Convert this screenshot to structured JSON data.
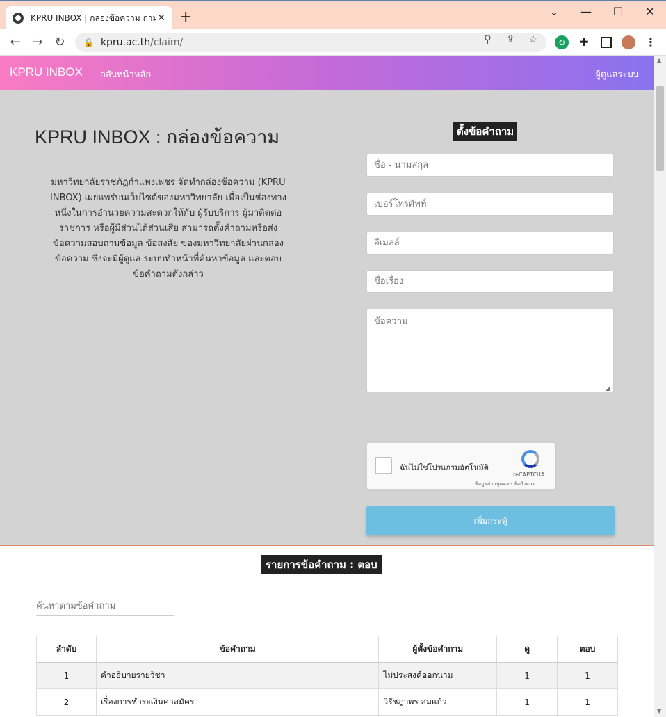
{
  "browser": {
    "tab_title": "KPRU INBOX | กล่องข้อความ ถาม ต",
    "tab_close": "✕",
    "new_tab": "+",
    "url_host": "kpru.ac.th",
    "url_path": "/claim/",
    "window_controls": [
      "minimize",
      "maximize",
      "close"
    ]
  },
  "nav": {
    "brand": "KPRU INBOX",
    "home_link": "กลับหน้าหลัก",
    "admin_link": "ผู้ดูแลระบบ"
  },
  "hero": {
    "title": "KPRU INBOX : กล่องข้อความ",
    "description": "มหาวิทยาลัยราชภัฏกำแพงเพชร จัดทำกล่องข้อความ (KPRU INBOX) เผยแพร่บนเว็บไซต์ของมหาวิทยาลัย เพื่อเป็นช่องทางหนึ่งในการอำนวยความสะดวกให้กับ ผู้รับบริการ ผู้มาติดต่อราชการ หรือผู้มีส่วนได้ส่วนเสีย สามารถตั้งคำถามหรือส่งข้อความสอบถามข้อมูล ข้อสงสัย ของมหาวิทยาลัยผ่านกล่องข้อความ ซึ่งจะมีผู้ดูแล ระบบทำหน้าที่ค้นหาข้อมูล และตอบข้อคำถามดังกล่าว"
  },
  "form": {
    "title": "ตั้งข้อคำถาม",
    "name_placeholder": "ชื่อ - นามสกุล",
    "phone_placeholder": "เบอร์โทรศัพท์",
    "email_placeholder": "อีเมลล์",
    "subject_placeholder": "ชื่อเรื่อง",
    "message_placeholder": "ข้อความ",
    "captcha_label": "ฉันไม่ใช่โปรแกรมอัตโนมัติ",
    "captcha_brand": "reCAPTCHA",
    "captcha_links": "ข้อมูลส่วนบุคคล - ข้อกำหนด",
    "submit_label": "เพิ่มกระทู้"
  },
  "list": {
    "title": "รายการข้อคำถาม : ตอบ",
    "search_placeholder": "ค้นหาตามข้อคำถาม",
    "columns": [
      "ลำดับ",
      "ข้อคำถาม",
      "ผู้ตั้งข้อคำถาม",
      "ดู",
      "ตอบ"
    ],
    "rows": [
      {
        "no": "1",
        "question": "คำอธิบายรายวิชา",
        "asker": "ไม่ประสงค์ออกนาม",
        "views": "1",
        "answers": "1"
      },
      {
        "no": "2",
        "question": "เรื่องการชำระเงินค่าสมัคร",
        "asker": "วิรัชฎาพร สมแก้ว",
        "views": "1",
        "answers": "1"
      }
    ]
  }
}
